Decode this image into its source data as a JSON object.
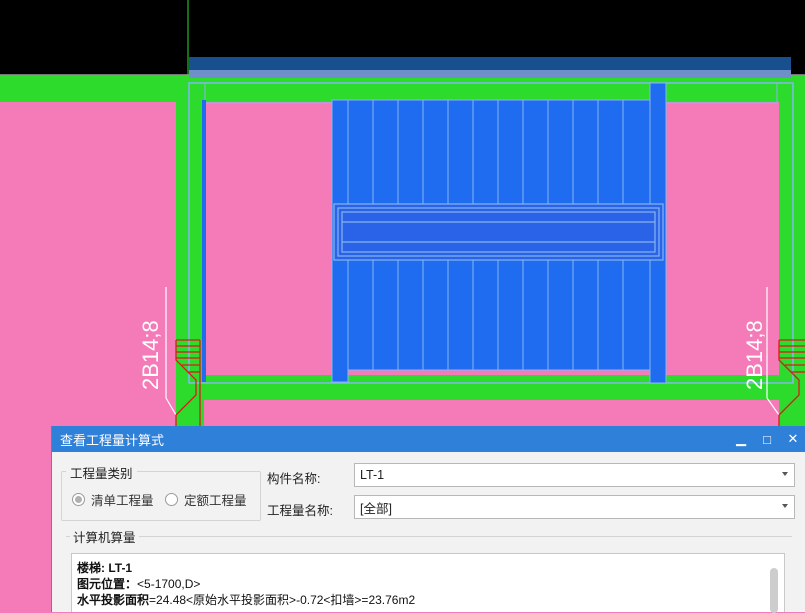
{
  "cad": {
    "rebar_label_left": "2B14;8",
    "rebar_label_right": "2B14;8"
  },
  "colors": {
    "background": "#f57ab8",
    "wall_green": "#2ddb2d",
    "stair_blue": "#1f6cf0",
    "title_blue": "#2f80d8"
  },
  "dialog": {
    "title": "查看工程量计算式",
    "minimize_icon": "▁",
    "maximize_icon": "□",
    "close_icon": "✕",
    "quantity_type_group": "工程量类别",
    "radio_bill": "清单工程量",
    "radio_quota": "定额工程量",
    "component_name_label": "构件名称:",
    "component_name_value": "LT-1",
    "quantity_name_label": "工程量名称:",
    "quantity_name_value": "[全部]",
    "computer_calc_label": "计算机算量",
    "calc_lines": {
      "line1_key": "楼梯: LT-1",
      "line2_key": "图元位置：",
      "line2_val": "<5-1700,D>",
      "line3_key": "水平投影面积",
      "line3_val": "=24.48<原始水平投影面积>-0.72<扣墙>=23.76m2"
    }
  }
}
